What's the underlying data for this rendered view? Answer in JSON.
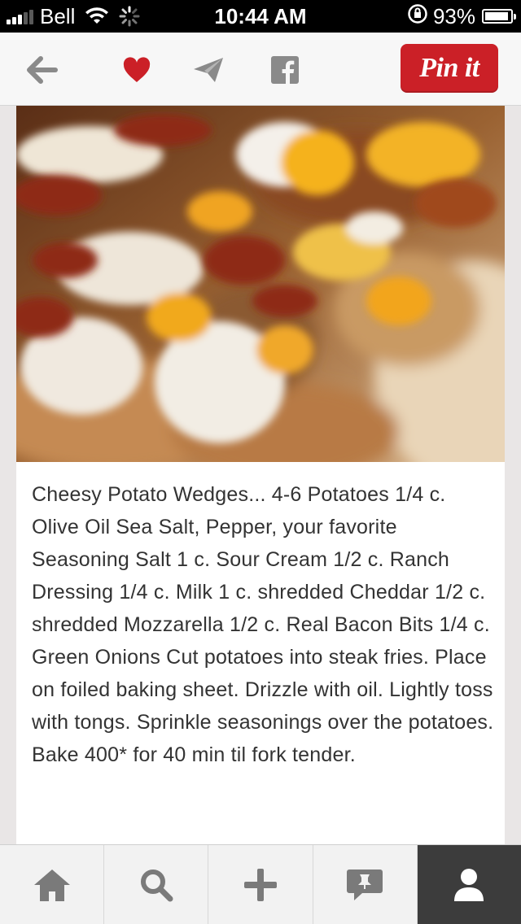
{
  "status_bar": {
    "carrier": "Bell",
    "time": "10:44 AM",
    "battery_percent": "93%",
    "battery_level": 0.93
  },
  "toolbar": {
    "back_icon": "back-arrow-icon",
    "like_icon": "heart-icon",
    "send_icon": "send-icon",
    "facebook_icon": "facebook-icon",
    "pin_it_label": "Pin it",
    "colors": {
      "heart": "#cb2027",
      "pin_it_bg": "#cb2027",
      "icon_gray": "#8a8a8a"
    }
  },
  "pin": {
    "description": "Cheesy Potato Wedges... 4-6 Potatoes 1/4 c. Olive Oil Sea Salt, Pepper, your favorite Seasoning Salt 1 c. Sour Cream 1/2 c. Ranch Dressing 1/4 c. Milk 1 c. shredded Cheddar 1/2 c. shredded Mozzarella 1/2 c. Real Bacon Bits 1/4 c. Green Onions Cut potatoes into steak fries. Place on foiled baking sheet. Drizzle with oil. Lightly toss with tongs. Sprinkle seasonings over the potatoes. Bake 400* for 40 min til fork tender."
  },
  "tab_bar": {
    "tabs": [
      {
        "icon": "home-icon",
        "active": false
      },
      {
        "icon": "search-icon",
        "active": false
      },
      {
        "icon": "plus-icon",
        "active": false
      },
      {
        "icon": "news-icon",
        "active": false
      },
      {
        "icon": "profile-icon",
        "active": true
      }
    ],
    "colors": {
      "icon": "#7a7a7a",
      "active_bg": "#3c3c3c",
      "active_icon": "#ffffff"
    }
  }
}
